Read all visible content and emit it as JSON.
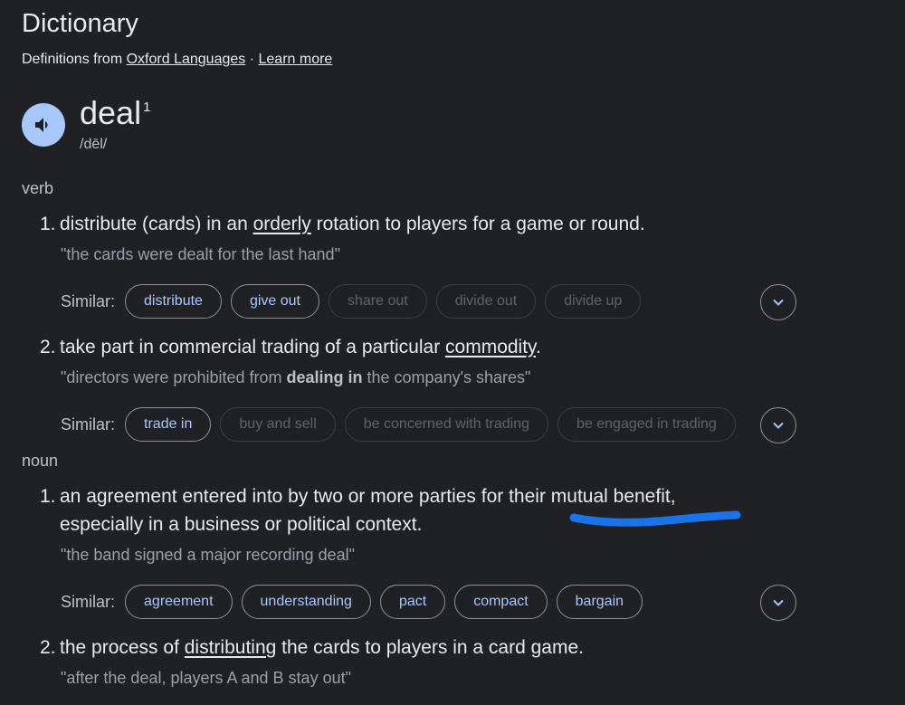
{
  "header": {
    "title": "Dictionary",
    "source_prefix": "Definitions from",
    "source_link": "Oxford Languages",
    "separator": "·",
    "learn_more": "Learn more"
  },
  "entry": {
    "word": "deal",
    "superscript": "1",
    "phonetic": "/dēl/"
  },
  "verb": {
    "label": "verb",
    "senses": [
      {
        "num": "1.",
        "def_before": "distribute (cards) in an ",
        "def_link": "orderly",
        "def_after": " rotation to players for a game or round.",
        "example": "\"the cards were dealt for the last hand\"",
        "similar_label": "Similar:",
        "similar": [
          {
            "label": "distribute",
            "active": true
          },
          {
            "label": "give out",
            "active": true
          },
          {
            "label": "share out",
            "active": false
          },
          {
            "label": "divide out",
            "active": false
          },
          {
            "label": "divide up",
            "active": false
          }
        ]
      },
      {
        "num": "2.",
        "def_before": "take part in commercial trading of a particular ",
        "def_link": "commodity",
        "def_after": ".",
        "example_before": "\"directors were prohibited from ",
        "example_bold": "dealing in",
        "example_after": " the company's shares\"",
        "similar_label": "Similar:",
        "similar": [
          {
            "label": "trade in",
            "active": true
          },
          {
            "label": "buy and sell",
            "active": false
          },
          {
            "label": "be concerned with trading",
            "active": false
          },
          {
            "label": "be engaged in trading",
            "active": false
          }
        ]
      }
    ]
  },
  "noun": {
    "label": "noun",
    "senses": [
      {
        "num": "1.",
        "def_line1": "an agreement entered into by two or more parties for their mutual benefit,",
        "def_line2": "especially in a business or political context.",
        "example": "\"the band signed a major recording deal\"",
        "similar_label": "Similar:",
        "similar": [
          {
            "label": "agreement",
            "active": true
          },
          {
            "label": "understanding",
            "active": true
          },
          {
            "label": "pact",
            "active": true
          },
          {
            "label": "compact",
            "active": true
          },
          {
            "label": "bargain",
            "active": true
          }
        ]
      },
      {
        "num": "2.",
        "def_before": "the process of ",
        "def_link": "distributing",
        "def_after": " the cards to players in a card game.",
        "example": "\"after the deal, players A and B stay out\""
      }
    ]
  },
  "colors": {
    "background": "#202124",
    "text": "#e8eaed",
    "chip_active": "#a8c7fa",
    "chip_inactive": "#5f6368",
    "annotation": "#1a73e8"
  }
}
